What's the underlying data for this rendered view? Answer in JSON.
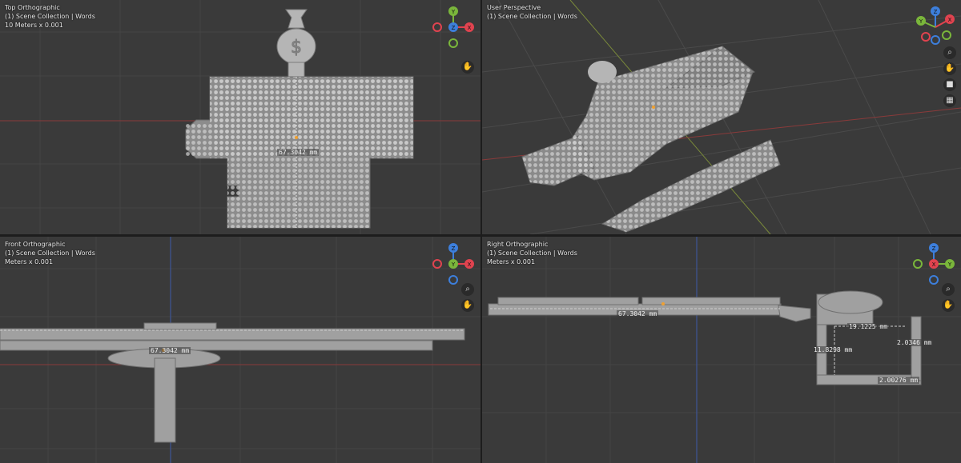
{
  "viewports": {
    "top": {
      "view_name": "Top Orthographic",
      "collection": "(1) Scene Collection | Words",
      "scale": "10 Meters x 0.001",
      "dimension": "67.3042 mm"
    },
    "perspective": {
      "view_name": "User Perspective",
      "collection": "(1) Scene Collection | Words"
    },
    "front": {
      "view_name": "Front Orthographic",
      "collection": "(1) Scene Collection | Words",
      "scale": "Meters x 0.001",
      "dimension": "67.3042 mm"
    },
    "right": {
      "view_name": "Right Orthographic",
      "collection": "(1) Scene Collection | Words",
      "scale": "Meters x 0.001",
      "dimensions": {
        "width": "67.3042 mm",
        "top": "19.1225 mm",
        "height": "11.8298 mm",
        "side": "2.0346 mm",
        "bottom": "2.00276 mm"
      }
    }
  },
  "gizmo": {
    "x": "X",
    "y": "Y",
    "z": "Z",
    "x_color": "#e0434f",
    "y_color": "#7ab63b",
    "z_color": "#3d7fdc"
  }
}
